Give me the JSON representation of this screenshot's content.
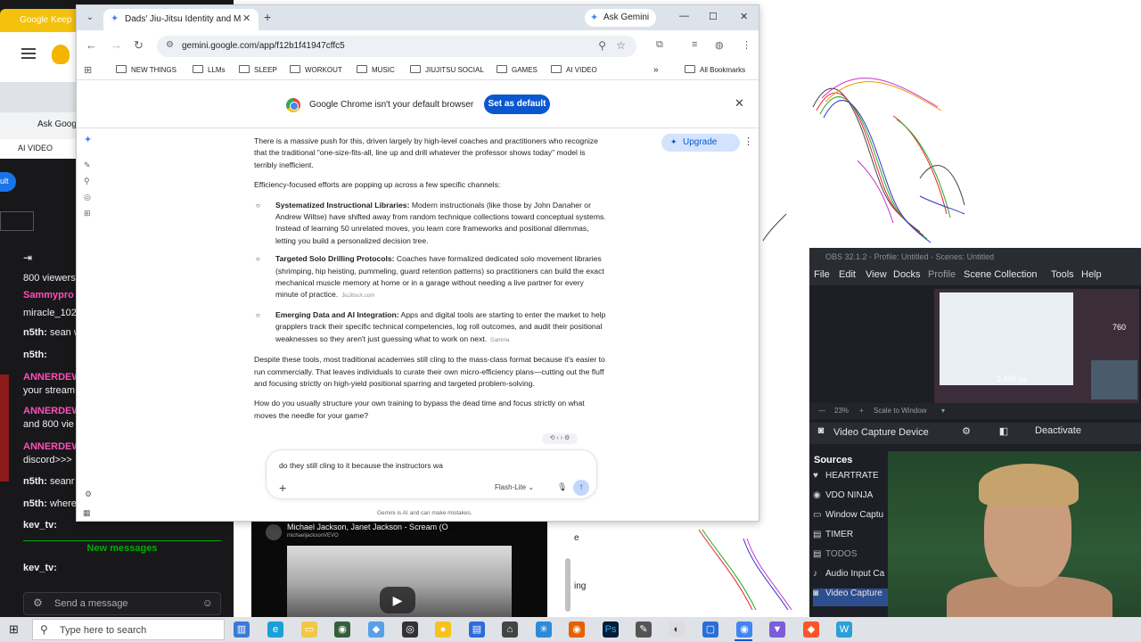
{
  "background_left": {
    "keep_tab": "Google Keep",
    "ask_google": "Ask Goog",
    "ai_video": "AI VIDEO",
    "blue_pill": "ult",
    "chat": [
      {
        "name": "",
        "text": "800 viewers",
        "color": "#efeff1"
      },
      {
        "name": "Sammypro",
        "text": "",
        "color": "#ff4fb8"
      },
      {
        "name": "",
        "text": "miracle_102",
        "color": "#efeff1"
      },
      {
        "name": "n5th:",
        "text": " sean w",
        "color": "#efeff1"
      },
      {
        "name": "n5th:",
        "text": "",
        "color": "#efeff1"
      },
      {
        "name": "ANNERDEW",
        "text": "",
        "color": "#ff4fb8"
      },
      {
        "name": "",
        "text": "your stream",
        "color": "#efeff1"
      },
      {
        "name": "ANNERDEW",
        "text": "",
        "color": "#ff4fb8"
      },
      {
        "name": "",
        "text": "and 800 vie",
        "color": "#efeff1"
      },
      {
        "name": "ANNERDEW",
        "text": "",
        "color": "#ff4fb8"
      },
      {
        "name": "",
        "text": "discord>>>",
        "color": "#efeff1"
      },
      {
        "name": "n5th:",
        "text": " seanr",
        "color": "#efeff1"
      },
      {
        "name": "n5th:",
        "text": " where",
        "color": "#efeff1"
      },
      {
        "name": "kev_tv:",
        "text": "",
        "color": "#efeff1"
      },
      {
        "name": "kev_tv:",
        "text": "",
        "color": "#efeff1"
      }
    ],
    "new_messages": "New messages",
    "send_placeholder": "Send a message"
  },
  "obs": {
    "title": "OBS 32.1.2 - Profile: Untitled - Scenes: Untitled",
    "menu": [
      "File",
      "Edit",
      "View",
      "Docks",
      "Profile",
      "Scene Collection",
      "Tools",
      "Help"
    ],
    "preview_num1": "760",
    "preview_num2": "1,495 px",
    "zoom": "23%",
    "scale_label": "Scale to Window",
    "source_label": "Video Capture Device",
    "deactivate": "Deactivate",
    "sources_header": "Sources",
    "sources": [
      {
        "icon": "heart-icon",
        "label": "HEARTRATE"
      },
      {
        "icon": "ninja-icon",
        "label": "VDO NINJA"
      },
      {
        "icon": "window-icon",
        "label": "Window Captu"
      },
      {
        "icon": "timer-icon",
        "label": "TIMER"
      },
      {
        "icon": "list-icon",
        "label": "TODOS"
      },
      {
        "icon": "mic-icon",
        "label": "Audio Input Ca"
      },
      {
        "icon": "camera-icon",
        "label": "Video Capture"
      }
    ]
  },
  "video": {
    "title": "Michael Jackson, Janet Jackson - Scream (O",
    "channel": "michaeljacksonVEVO",
    "side_text": [
      "e",
      "ing"
    ]
  },
  "chrome": {
    "tab_title": "Dads' Jiu-Jitsu Identity and Mo",
    "ask_gemini": "Ask Gemini",
    "url": "gemini.google.com/app/f12b1f41947cffc5",
    "bookmarks": [
      "NEW THINGS",
      "LLMs",
      "SLEEP",
      "WORKOUT",
      "MUSIC",
      "JIUJITSU SOCIAL",
      "GAMES",
      "AI VIDEO"
    ],
    "all_bookmarks": "All Bookmarks",
    "infobar_message": "Google Chrome isn't your default browser",
    "set_default": "Set as default"
  },
  "gemini": {
    "upgrade": "Upgrade",
    "intro": "There is a massive push for this, driven largely by high-level coaches and practitioners who recognize that the traditional \"one-size-fits-all, line up and drill whatever the professor shows today\" model is terribly inefficient.",
    "lead": "Efficiency-focused efforts are popping up across a few specific channels:",
    "bullets": [
      {
        "title": "Systematized Instructional Libraries:",
        "text": " Modern instructionals (like those by John Danaher or Andrew Wiltse) have shifted away from random technique collections toward conceptual systems. Instead of learning 50 unrelated moves, you learn core frameworks and positional dilemmas, letting you build a personalized decision tree.",
        "source": ""
      },
      {
        "title": "Targeted Solo Drilling Protocols:",
        "text": " Coaches have formalized dedicated solo movement libraries (shrimping, hip heisting, pummeling, guard retention patterns) so practitioners can build the exact mechanical muscle memory at home or in a garage without needing a live partner for every minute of practice.",
        "source": "JiuJitsuX.com"
      },
      {
        "title": "Emerging Data and AI Integration:",
        "text": " Apps and digital tools are starting to enter the market to help grapplers track their specific technical competencies, log roll outcomes, and audit their positional weaknesses so they aren't just guessing what to work on next.",
        "source": "Gamma"
      }
    ],
    "para2": "Despite these tools, most traditional academies still cling to the mass-class format because it's easier to run commercially. That leaves individuals to curate their own micro-efficiency plans—cutting out the fluff and focusing strictly on high-yield positional sparring and targeted problem-solving.",
    "question": "How do you usually structure your own training to bypass the dead time and focus strictly on what moves the needle for your game?",
    "input_value": "do they still cling to it because the instructors wa",
    "model": "Flash-Lite",
    "disclaimer": "Gemini is AI and can make mistakes."
  },
  "taskbar": {
    "search": "Type here to search"
  }
}
